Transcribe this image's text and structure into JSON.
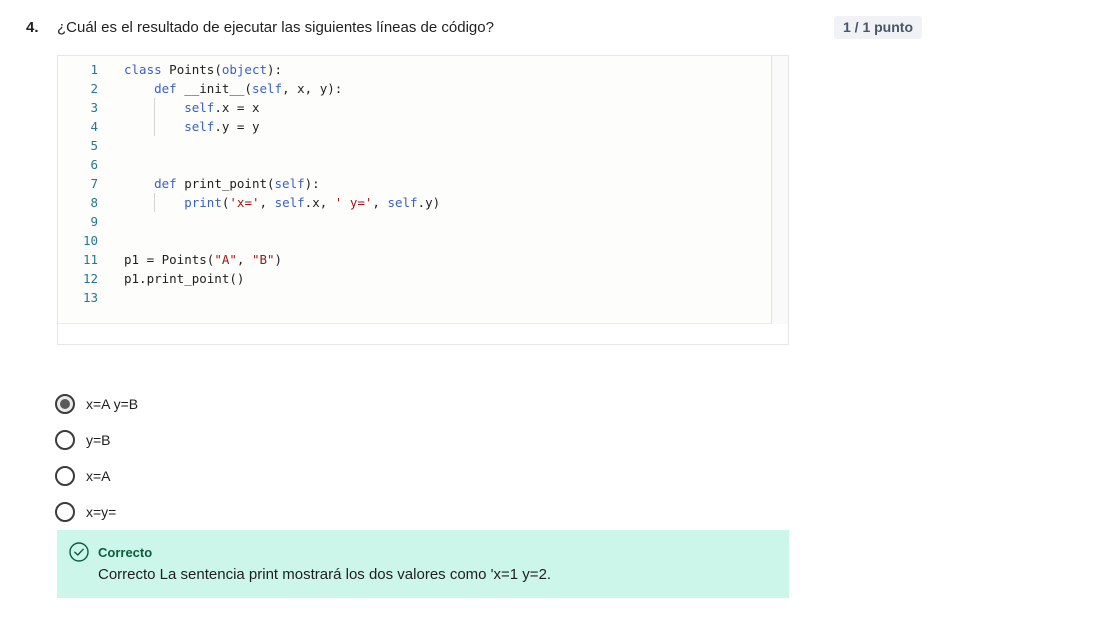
{
  "question": {
    "number": "4.",
    "text": "¿Cuál es el resultado de ejecutar las siguientes líneas de código?",
    "score": "1 / 1 punto"
  },
  "code": {
    "lines": [
      {
        "n": "1",
        "parts": [
          {
            "t": "class",
            "c": "kw"
          },
          {
            "t": " Points("
          },
          {
            "t": "object",
            "c": "kw"
          },
          {
            "t": "):"
          }
        ]
      },
      {
        "n": "2",
        "parts": [
          {
            "t": "    "
          },
          {
            "t": "def",
            "c": "kw"
          },
          {
            "t": " __init__("
          },
          {
            "t": "self",
            "c": "kw"
          },
          {
            "t": ", x, y):"
          }
        ]
      },
      {
        "n": "3",
        "parts": [
          {
            "t": "        "
          },
          {
            "t": "self",
            "c": "kw"
          },
          {
            "t": ".x = x"
          }
        ]
      },
      {
        "n": "4",
        "parts": [
          {
            "t": "        "
          },
          {
            "t": "self",
            "c": "kw"
          },
          {
            "t": ".y = y"
          }
        ]
      },
      {
        "n": "5",
        "parts": []
      },
      {
        "n": "6",
        "parts": []
      },
      {
        "n": "7",
        "parts": [
          {
            "t": "    "
          },
          {
            "t": "def",
            "c": "kw"
          },
          {
            "t": " print_point("
          },
          {
            "t": "self",
            "c": "kw"
          },
          {
            "t": "):"
          }
        ]
      },
      {
        "n": "8",
        "parts": [
          {
            "t": "        "
          },
          {
            "t": "print",
            "c": "kw"
          },
          {
            "t": "("
          },
          {
            "t": "'x='",
            "c": "str"
          },
          {
            "t": ", "
          },
          {
            "t": "self",
            "c": "kw"
          },
          {
            "t": ".x, "
          },
          {
            "t": "' y='",
            "c": "str"
          },
          {
            "t": ", "
          },
          {
            "t": "self",
            "c": "kw"
          },
          {
            "t": ".y)"
          }
        ]
      },
      {
        "n": "9",
        "parts": []
      },
      {
        "n": "10",
        "parts": []
      },
      {
        "n": "11",
        "parts": [
          {
            "t": "p1 = Points("
          },
          {
            "t": "\"A\"",
            "c": "str"
          },
          {
            "t": ", "
          },
          {
            "t": "\"B\"",
            "c": "str"
          },
          {
            "t": ")"
          }
        ]
      },
      {
        "n": "12",
        "parts": [
          {
            "t": "p1.print_point()"
          }
        ]
      },
      {
        "n": "13",
        "parts": []
      }
    ]
  },
  "options": [
    {
      "label": "x=A y=B",
      "checked": true
    },
    {
      "label": "y=B",
      "checked": false
    },
    {
      "label": "x=A",
      "checked": false
    },
    {
      "label": "x=y=",
      "checked": false
    }
  ],
  "feedback": {
    "title": "Correcto",
    "text": "Correcto La sentencia print mostrará los dos valores como 'x=1 y=2.",
    "accent": "#0b5e3e",
    "background": "#cdf6ea"
  }
}
